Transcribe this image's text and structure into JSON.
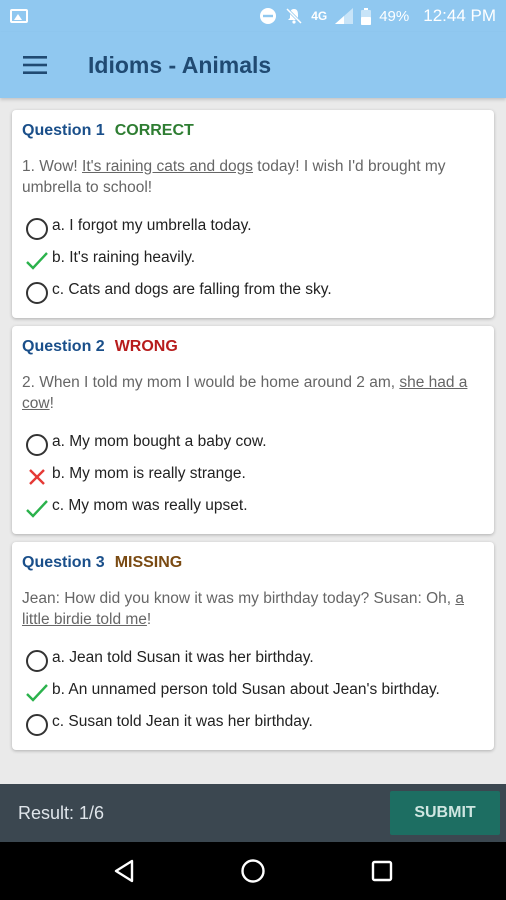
{
  "status_bar": {
    "network": "4G",
    "battery": "49%",
    "time": "12:44 PM"
  },
  "app_bar": {
    "title": "Idioms - Animals",
    "menu_icon": "hamburger-menu-icon"
  },
  "colors": {
    "app_bar": "#90c8f0",
    "title": "#204a72",
    "question_label": "#1a4f8a",
    "correct": "#2e7d32",
    "wrong": "#b71c1c",
    "missing": "#7a4a12",
    "check": "#2bb24c",
    "cross": "#e53935",
    "submit": "#1d6e62",
    "bottom_bar": "#3b4750"
  },
  "questions": [
    {
      "label": "Question 1",
      "status": "CORRECT",
      "text_before": "1. Wow! ",
      "idiom": "It's raining cats and dogs",
      "text_after": " today! I wish I'd brought my umbrella to school!",
      "options": [
        {
          "text": "a. I forgot my umbrella today.",
          "icon": "radio"
        },
        {
          "text": "b. It's raining heavily.",
          "icon": "check"
        },
        {
          "text": "c. Cats and dogs are falling from the sky.",
          "icon": "radio"
        }
      ]
    },
    {
      "label": "Question 2",
      "status": "WRONG",
      "text_before": "2. When I told my mom I would be home around 2 am, ",
      "idiom": "she had a cow",
      "text_after": "!",
      "options": [
        {
          "text": "a. My mom bought a baby cow.",
          "icon": "radio"
        },
        {
          "text": "b. My mom is really strange.",
          "icon": "cross"
        },
        {
          "text": "c. My mom was really upset.",
          "icon": "check"
        }
      ]
    },
    {
      "label": "Question 3",
      "status": "MISSING",
      "text_before": "Jean: How did you know it was my birthday today? Susan: Oh, ",
      "idiom": "a little birdie told me",
      "text_after": "!",
      "options": [
        {
          "text": "a. Jean told Susan it was her birthday.",
          "icon": "radio"
        },
        {
          "text": "b. An unnamed person told Susan about Jean's birthday.",
          "icon": "check"
        },
        {
          "text": "c. Susan told Jean it was her birthday.",
          "icon": "radio"
        }
      ]
    }
  ],
  "bottom_bar": {
    "result": "Result: 1/6",
    "submit_label": "SUBMIT"
  },
  "nav_bar": {
    "back_icon": "back-icon",
    "home_icon": "home-icon",
    "recents_icon": "recents-icon"
  }
}
